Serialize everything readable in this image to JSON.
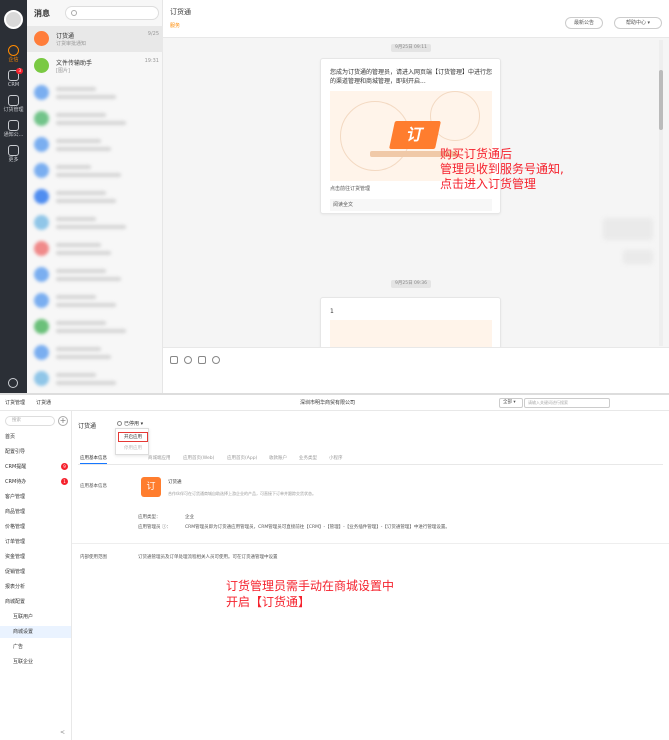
{
  "top": {
    "sidebar": {
      "items": [
        {
          "label": "企信",
          "icon": "chat-bubble-icon"
        },
        {
          "label": "CRM",
          "icon": "crm-icon",
          "badge": "3"
        },
        {
          "label": "订货管理",
          "icon": "box-icon"
        },
        {
          "label": "通知公...",
          "icon": "megaphone-icon"
        },
        {
          "label": "更多",
          "icon": "grid-icon"
        }
      ]
    },
    "panel": {
      "title": "消息",
      "search_placeholder": "Q",
      "plus": "+",
      "conversations": [
        {
          "name": "订货通",
          "sub": "订货审批通知",
          "time": "9/25",
          "color": "#ff7d3a"
        },
        {
          "name": "文件传输助手",
          "sub": "[图片]",
          "time": "19:31",
          "color": "#7ac943"
        }
      ]
    },
    "chat": {
      "title": "订货通",
      "subtitle": "服务",
      "btn_announce": "最新公告",
      "btn_help": "帮助中心",
      "timestamp1": "9月25日 09:11",
      "timestamp2": "9月25日 09:36",
      "card_text": "您成为订货通的管理员，请进入网页端【订货管理】中进行您的渠道管理和商城管理，即刻开启...",
      "card_glyph": "订",
      "card_link": "点击前往订货管理",
      "card_footer": "阅读全文",
      "card2_text": "1",
      "annotation": [
        "购买订货通后",
        "管理员收到服务号通知,",
        "点击进入订货管理"
      ]
    }
  },
  "bottom": {
    "topbar": {
      "tabs": [
        "订货管理",
        "订货通"
      ],
      "company": "深圳市明华商贸有限公司",
      "select": "全部 ▾",
      "search_placeholder": "请输入关键词进行搜索"
    },
    "nav": {
      "search_placeholder": "搜索",
      "plus": "+",
      "items": [
        {
          "label": "首页",
          "level": 0
        },
        {
          "label": "配置引导",
          "level": 0
        },
        {
          "label": "CRM提醒",
          "level": 0,
          "badge": "9"
        },
        {
          "label": "CRM待办",
          "level": 0,
          "badge": "1"
        },
        {
          "label": "客户管理",
          "level": 0
        },
        {
          "label": "商品管理",
          "level": 0
        },
        {
          "label": "价格管理",
          "level": 0
        },
        {
          "label": "订单管理",
          "level": 0
        },
        {
          "label": "资金管理",
          "level": 0
        },
        {
          "label": "促销管理",
          "level": 0
        },
        {
          "label": "报表分析",
          "level": 0
        },
        {
          "label": "商城配置",
          "level": 0
        },
        {
          "label": "互联用户",
          "level": 1
        },
        {
          "label": "商城设置",
          "level": 1,
          "selected": true
        },
        {
          "label": "广告",
          "level": 1
        },
        {
          "label": "互联企业",
          "level": 1
        }
      ],
      "collapse": "<"
    },
    "content": {
      "title": "订货通",
      "status": "已停用 ▾",
      "menu": [
        {
          "label": "开启应用",
          "highlight": true
        },
        {
          "label": "停用应用",
          "disabled": true
        }
      ],
      "tabs": [
        "应用基本信息",
        "商城端应用",
        "应用首页(Web)",
        "应用首页(App)",
        "收款账户",
        "业务类型",
        "小程序"
      ],
      "section_basic": "应用基本信息",
      "app_icon_glyph": "订",
      "app_name": "订货通",
      "app_desc": "合作伙伴可在订货通商城自助选择上游企业的产品，可直接下订单并跟踪交货状态。",
      "type_label": "应用类型：",
      "type_value": "企业",
      "admin_label": "应用管理员 ⓘ：",
      "admin_value": "CRM管理员即为订货通应用管理员，CRM管理员可直接前往【CRM】-【管理】-【业务插件管理】-【订货通管理】中进行管理设置。",
      "section_scope": "内部使用范围",
      "scope_value": "订货通管理员及订单处理流程相关人员可使用。可在订货通管理中设置",
      "annotation": [
        "订货管理员需手动在商城设置中",
        "开启【订货通】"
      ]
    }
  }
}
